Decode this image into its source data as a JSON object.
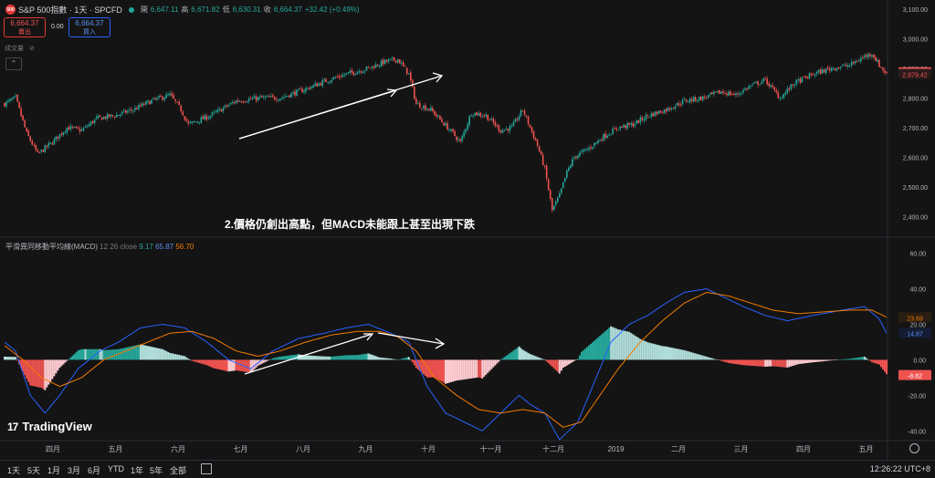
{
  "header": {
    "symbol_badge": "500",
    "symbol_title": "S&P 500指數 · 1天 · SPCFD",
    "ohlc": {
      "o_label": "開",
      "o": "6,647.11",
      "h_label": "高",
      "h": "6,671.82",
      "l_label": "低",
      "l": "6,630.31",
      "c_label": "收",
      "c": "6,664.37",
      "chg": "+32.42 (+0.49%)"
    },
    "sell_price": "6,664.37",
    "sell_label": "賣出",
    "buy_price": "6,664.37",
    "buy_label": "買入",
    "spread": "0.00",
    "volume_label": "成交量",
    "collapse_label": "⌃"
  },
  "annotation": "2.價格仍創出高點，但MACD未能跟上甚至出現下跌",
  "macd_legend": {
    "name": "平滑異同移動平均線(MACD)",
    "params": "12 26 close",
    "hist": "9.17",
    "macd": "65.87",
    "signal": "56.70"
  },
  "logo_text": "TradingView",
  "logo_mark": "17",
  "footer": {
    "ranges": [
      "1天",
      "5天",
      "1月",
      "3月",
      "6月",
      "YTD",
      "1年",
      "5年",
      "全部"
    ],
    "time": "12:26:22 UTC+8"
  },
  "colors": {
    "up": "#26a69a",
    "down": "#ef5350",
    "macd": "#2962ff",
    "signal": "#f57c00",
    "hist_up": "#26a69a",
    "hist_down": "#ef5350"
  },
  "chart_data": [
    {
      "type": "candlestick",
      "title": "",
      "y_ticks": [
        "3,100.00",
        "3,000.00",
        "2,900.00",
        "2,800.00",
        "2,700.00",
        "2,600.00",
        "2,500.00",
        "2,400.00"
      ],
      "ylim": [
        2330,
        3130
      ],
      "x_ticks": [
        "四月",
        "五月",
        "六月",
        "七月",
        "八月",
        "九月",
        "十月",
        "十一月",
        "十二月",
        "2019",
        "二月",
        "三月",
        "四月",
        "五月"
      ],
      "last_price_tags": [
        {
          "value": "2,884.43"
        },
        {
          "value": "2,879.42"
        }
      ],
      "anchors": [
        [
          0,
          2780
        ],
        [
          6,
          2800
        ],
        [
          12,
          2680
        ],
        [
          18,
          2610
        ],
        [
          26,
          2650
        ],
        [
          34,
          2700
        ],
        [
          42,
          2690
        ],
        [
          50,
          2730
        ],
        [
          60,
          2740
        ],
        [
          70,
          2760
        ],
        [
          80,
          2790
        ],
        [
          90,
          2810
        ],
        [
          96,
          2760
        ],
        [
          100,
          2710
        ],
        [
          112,
          2740
        ],
        [
          126,
          2790
        ],
        [
          140,
          2800
        ],
        [
          150,
          2800
        ],
        [
          164,
          2830
        ],
        [
          176,
          2860
        ],
        [
          186,
          2880
        ],
        [
          198,
          2900
        ],
        [
          206,
          2920
        ],
        [
          214,
          2930
        ],
        [
          220,
          2880
        ],
        [
          224,
          2780
        ],
        [
          232,
          2760
        ],
        [
          238,
          2720
        ],
        [
          244,
          2680
        ],
        [
          248,
          2650
        ],
        [
          254,
          2750
        ],
        [
          262,
          2740
        ],
        [
          270,
          2690
        ],
        [
          276,
          2700
        ],
        [
          282,
          2760
        ],
        [
          286,
          2700
        ],
        [
          290,
          2640
        ],
        [
          294,
          2560
        ],
        [
          298,
          2420
        ],
        [
          302,
          2470
        ],
        [
          306,
          2550
        ],
        [
          310,
          2600
        ],
        [
          318,
          2630
        ],
        [
          326,
          2670
        ],
        [
          334,
          2700
        ],
        [
          342,
          2710
        ],
        [
          350,
          2740
        ],
        [
          360,
          2760
        ],
        [
          370,
          2790
        ],
        [
          380,
          2800
        ],
        [
          390,
          2820
        ],
        [
          398,
          2810
        ],
        [
          406,
          2840
        ],
        [
          414,
          2860
        ],
        [
          422,
          2800
        ],
        [
          430,
          2850
        ],
        [
          440,
          2880
        ],
        [
          450,
          2900
        ],
        [
          460,
          2910
        ],
        [
          468,
          2940
        ],
        [
          472,
          2950
        ],
        [
          476,
          2910
        ],
        [
          480,
          2880
        ]
      ]
    },
    {
      "type": "macd",
      "title": "平滑異同移動平均線(MACD)",
      "y_ticks": [
        "60.00",
        "40.00",
        "20.00",
        "0.00",
        "-20.00",
        "-40.00"
      ],
      "ylim": [
        -45,
        66
      ],
      "value_tags": [
        {
          "value": "23.69"
        },
        {
          "value": "14.87"
        },
        {
          "value": "-8.82"
        }
      ],
      "macd_anchors": [
        [
          0,
          10
        ],
        [
          6,
          5
        ],
        [
          14,
          -20
        ],
        [
          22,
          -30
        ],
        [
          30,
          -20
        ],
        [
          40,
          -5
        ],
        [
          52,
          5
        ],
        [
          62,
          10
        ],
        [
          74,
          18
        ],
        [
          86,
          20
        ],
        [
          98,
          18
        ],
        [
          110,
          10
        ],
        [
          122,
          0
        ],
        [
          134,
          -5
        ],
        [
          146,
          5
        ],
        [
          160,
          12
        ],
        [
          174,
          15
        ],
        [
          186,
          18
        ],
        [
          198,
          20
        ],
        [
          210,
          15
        ],
        [
          220,
          10
        ],
        [
          230,
          -15
        ],
        [
          240,
          -30
        ],
        [
          250,
          -35
        ],
        [
          260,
          -40
        ],
        [
          270,
          -30
        ],
        [
          280,
          -20
        ],
        [
          286,
          -25
        ],
        [
          294,
          -30
        ],
        [
          302,
          -45
        ],
        [
          312,
          -35
        ],
        [
          322,
          -10
        ],
        [
          330,
          10
        ],
        [
          340,
          20
        ],
        [
          350,
          25
        ],
        [
          360,
          32
        ],
        [
          370,
          38
        ],
        [
          382,
          40
        ],
        [
          392,
          35
        ],
        [
          402,
          30
        ],
        [
          414,
          25
        ],
        [
          426,
          22
        ],
        [
          440,
          25
        ],
        [
          456,
          28
        ],
        [
          468,
          30
        ],
        [
          476,
          23
        ],
        [
          480,
          15
        ]
      ],
      "signal_anchors": [
        [
          0,
          8
        ],
        [
          10,
          0
        ],
        [
          20,
          -10
        ],
        [
          30,
          -15
        ],
        [
          42,
          -10
        ],
        [
          54,
          0
        ],
        [
          66,
          5
        ],
        [
          78,
          10
        ],
        [
          90,
          15
        ],
        [
          102,
          16
        ],
        [
          114,
          12
        ],
        [
          126,
          5
        ],
        [
          138,
          2
        ],
        [
          150,
          5
        ],
        [
          164,
          10
        ],
        [
          178,
          14
        ],
        [
          192,
          16
        ],
        [
          204,
          16
        ],
        [
          214,
          13
        ],
        [
          224,
          5
        ],
        [
          234,
          -10
        ],
        [
          246,
          -20
        ],
        [
          258,
          -28
        ],
        [
          270,
          -30
        ],
        [
          282,
          -28
        ],
        [
          294,
          -30
        ],
        [
          304,
          -38
        ],
        [
          314,
          -35
        ],
        [
          324,
          -20
        ],
        [
          334,
          -5
        ],
        [
          346,
          10
        ],
        [
          358,
          22
        ],
        [
          370,
          32
        ],
        [
          382,
          38
        ],
        [
          394,
          36
        ],
        [
          406,
          32
        ],
        [
          418,
          28
        ],
        [
          432,
          26
        ],
        [
          446,
          27
        ],
        [
          460,
          28
        ],
        [
          472,
          28
        ],
        [
          480,
          24
        ]
      ]
    }
  ]
}
